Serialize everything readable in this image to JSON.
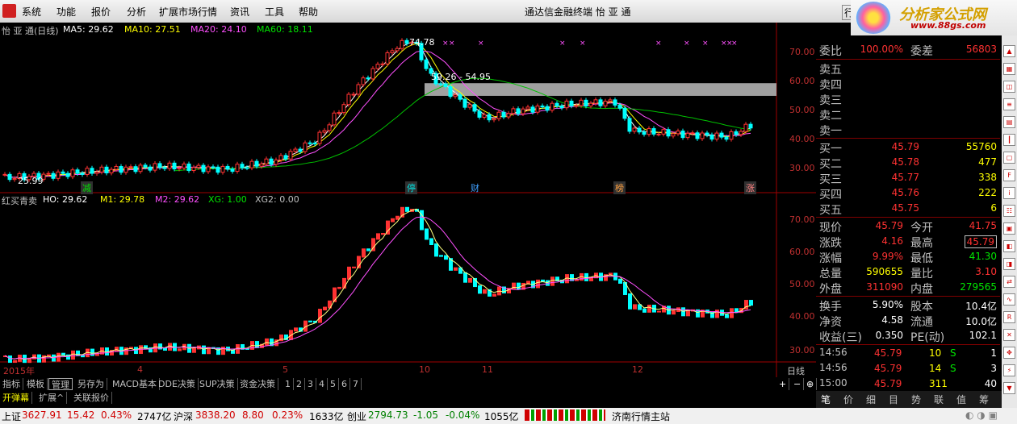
{
  "menu": {
    "items": [
      "系统",
      "功能",
      "报价",
      "分析",
      "扩展市场行情",
      "资讯",
      "工具",
      "帮助"
    ],
    "title": "通达信金融终端  怡 亚 通",
    "hidden_btn": "行"
  },
  "brand": {
    "text": "分析家公式网",
    "url": "www.88gs.com"
  },
  "upper": {
    "name": "怡 亚 通(日线)",
    "ma5": "MA5: 29.62",
    "ma10": "MA10: 27.51",
    "ma20": "MA20: 24.10",
    "ma60": "MA60: 18.11",
    "ticks": [
      "70.00",
      "60.00",
      "50.00",
      "40.00",
      "30.00"
    ],
    "high_label": "74.78",
    "low_label": "25.99",
    "range_label": "59.26 - 54.95",
    "markers": [
      "减",
      "停",
      "财",
      "榜",
      "涨"
    ]
  },
  "lower": {
    "name": "红买青卖",
    "ho": "HO: 29.62",
    "m1": "M1: 29.78",
    "m2": "M2: 29.62",
    "xg": "XG: 1.00",
    "xg2": "XG2: 0.00",
    "ticks": [
      "70.00",
      "60.00",
      "50.00",
      "40.00",
      "30.00"
    ]
  },
  "xaxis": {
    "labels": [
      "2015年",
      "4",
      "5",
      "10",
      "11",
      "12"
    ],
    "period": "日线"
  },
  "tabs": [
    "指标",
    "模板",
    "管理",
    "另存为",
    "MACD基本",
    "DDE决策",
    "SUP决策",
    "资金决策",
    "1",
    "2",
    "3",
    "4",
    "5",
    "6",
    "7"
  ],
  "tabs2": [
    "开弹幕",
    "扩展^",
    "关联报价"
  ],
  "quote": {
    "wb_label": "委比",
    "wb": "100.00%",
    "wc_label": "委差",
    "wc": "56803",
    "sells": [
      {
        "l": "卖五"
      },
      {
        "l": "卖四"
      },
      {
        "l": "卖三"
      },
      {
        "l": "卖二"
      },
      {
        "l": "卖一"
      }
    ],
    "buys": [
      {
        "l": "买一",
        "p": "45.79",
        "v": "55760"
      },
      {
        "l": "买二",
        "p": "45.78",
        "v": "477"
      },
      {
        "l": "买三",
        "p": "45.77",
        "v": "338"
      },
      {
        "l": "买四",
        "p": "45.76",
        "v": "222"
      },
      {
        "l": "买五",
        "p": "45.75",
        "v": "6"
      }
    ],
    "stats": [
      {
        "a": "现价",
        "av": "45.79",
        "b": "今开",
        "bv": "41.75"
      },
      {
        "a": "涨跌",
        "av": "4.16",
        "b": "最高",
        "bv": "45.79"
      },
      {
        "a": "涨幅",
        "av": "9.99%",
        "b": "最低",
        "bv": "41.30"
      },
      {
        "a": "总量",
        "av": "590655",
        "b": "量比",
        "bv": "3.10"
      },
      {
        "a": "外盘",
        "av": "311090",
        "b": "内盘",
        "bv": "279565"
      },
      {
        "a": "换手",
        "av": "5.90%",
        "b": "股本",
        "bv": "10.4亿"
      },
      {
        "a": "净资",
        "av": "4.58",
        "b": "流通",
        "bv": "10.0亿"
      },
      {
        "a": "收益(三)",
        "av": "0.350",
        "b": "PE(动)",
        "bv": "102.1"
      }
    ],
    "ticks": [
      {
        "t": "14:56",
        "p": "45.79",
        "v": "10",
        "s": "S",
        "n": "1"
      },
      {
        "t": "14:56",
        "p": "45.79",
        "v": "14",
        "s": "S",
        "n": "3"
      },
      {
        "t": "15:00",
        "p": "45.79",
        "v": "311",
        "s": "",
        "n": "40"
      }
    ],
    "tabs": [
      "笔",
      "价",
      "细",
      "目",
      "势",
      "联",
      "值",
      "筹"
    ]
  },
  "status": {
    "sh_label": "上证",
    "sh": "3627.91",
    "sh_chg": "15.42",
    "sh_pct": "0.43%",
    "sh_amt": "2747亿",
    "sz_label": "沪深",
    "sz": "3838.20",
    "sz_chg": "8.80",
    "sz_pct": "0.23%",
    "sz_amt": "1633亿",
    "cy_label": "创业",
    "cy": "2794.73",
    "cy_chg": "-1.05",
    "cy_pct": "-0.04%",
    "cy_amt": "1055亿",
    "site": "济南行情主站"
  }
}
